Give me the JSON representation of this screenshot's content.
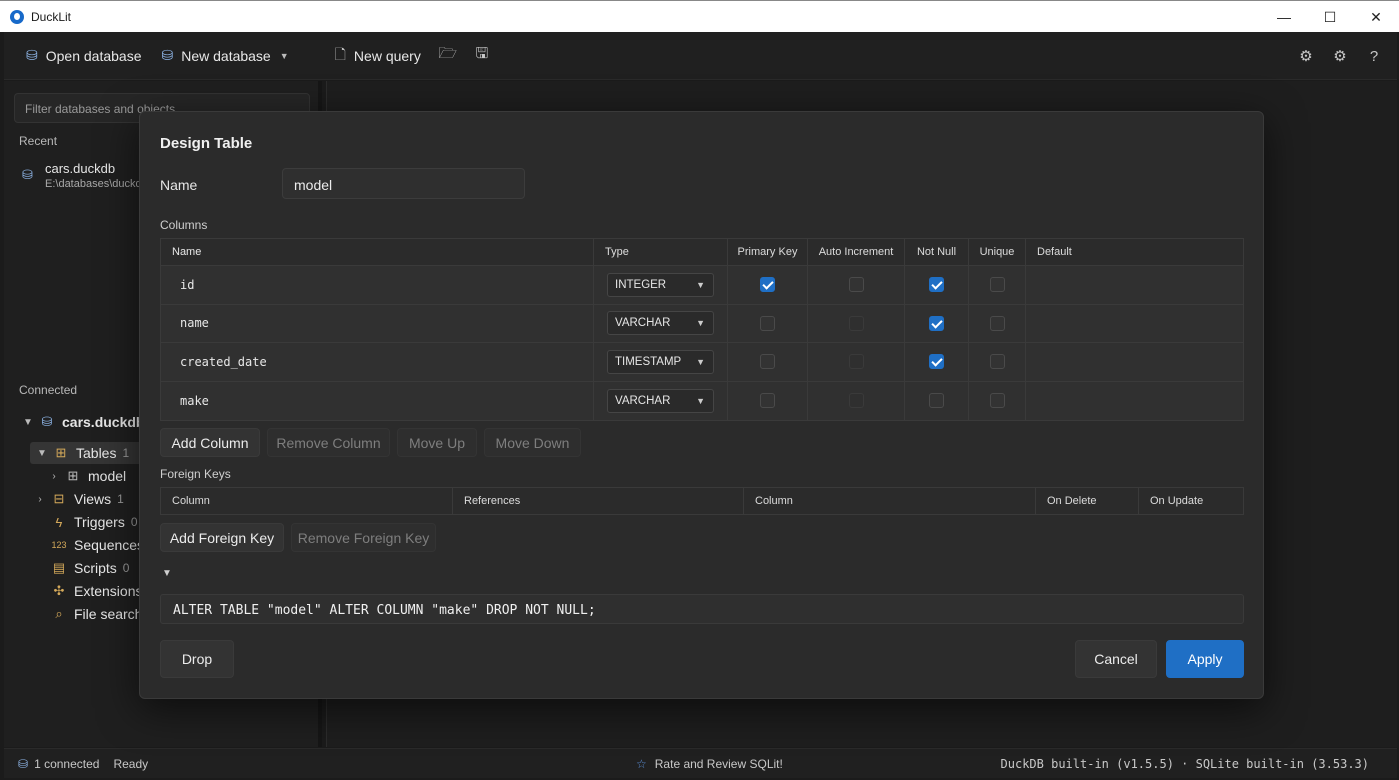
{
  "window": {
    "title": "DuckLit",
    "controls": [
      "—",
      "☐",
      "✕"
    ]
  },
  "toolbar": {
    "open_database": "Open database",
    "new_database": "New database",
    "new_query": "New query"
  },
  "sidebar": {
    "filter_placeholder": "Filter databases and objects",
    "recent_label": "Recent",
    "recent": [
      {
        "name": "cars.duckdb",
        "path": "E:\\databases\\duckdb"
      }
    ],
    "connected_label": "Connected",
    "tree": {
      "db": "cars.duckdb",
      "tables": {
        "label": "Tables",
        "count": "1"
      },
      "model": "model",
      "views": {
        "label": "Views",
        "count": "1"
      },
      "triggers": {
        "label": "Triggers",
        "count": "0"
      },
      "sequences": {
        "label": "Sequences"
      },
      "scripts": {
        "label": "Scripts",
        "count": "0"
      },
      "extensions": {
        "label": "Extensions"
      },
      "file_search": {
        "label": "File search"
      }
    }
  },
  "dialog": {
    "title": "Design Table",
    "name_label": "Name",
    "name_value": "model",
    "columns_label": "Columns",
    "headers": {
      "name": "Name",
      "type": "Type",
      "primary_key": "Primary Key",
      "auto_increment": "Auto Increment",
      "not_null": "Not Null",
      "unique": "Unique",
      "default": "Default"
    },
    "columns": [
      {
        "name": "id",
        "type": "INTEGER",
        "pk": true,
        "ai": false,
        "nn": true,
        "uq": false,
        "default": ""
      },
      {
        "name": "name",
        "type": "VARCHAR",
        "pk": false,
        "ai": false,
        "nn": true,
        "uq": false,
        "default": ""
      },
      {
        "name": "created_date",
        "type": "TIMESTAMP",
        "pk": false,
        "ai": false,
        "nn": true,
        "uq": false,
        "default": ""
      },
      {
        "name": "make",
        "type": "VARCHAR",
        "pk": false,
        "ai": false,
        "nn": false,
        "uq": false,
        "default": ""
      }
    ],
    "buttons": {
      "add_column": "Add Column",
      "remove_column": "Remove Column",
      "move_up": "Move Up",
      "move_down": "Move Down",
      "add_fk": "Add Foreign Key",
      "remove_fk": "Remove Foreign Key",
      "drop": "Drop",
      "cancel": "Cancel",
      "apply": "Apply"
    },
    "fk_label": "Foreign Keys",
    "fk_headers": {
      "column": "Column",
      "references": "References",
      "ref_column": "Column",
      "on_delete": "On Delete",
      "on_update": "On Update"
    },
    "sql": "ALTER TABLE \"model\" ALTER COLUMN \"make\" DROP NOT NULL;"
  },
  "status": {
    "connected": "1 connected",
    "state": "Ready",
    "rate": "Rate and Review SQLit!",
    "versions": "DuckDB built-in (v1.5.5) · SQLite built-in (3.53.3)"
  }
}
